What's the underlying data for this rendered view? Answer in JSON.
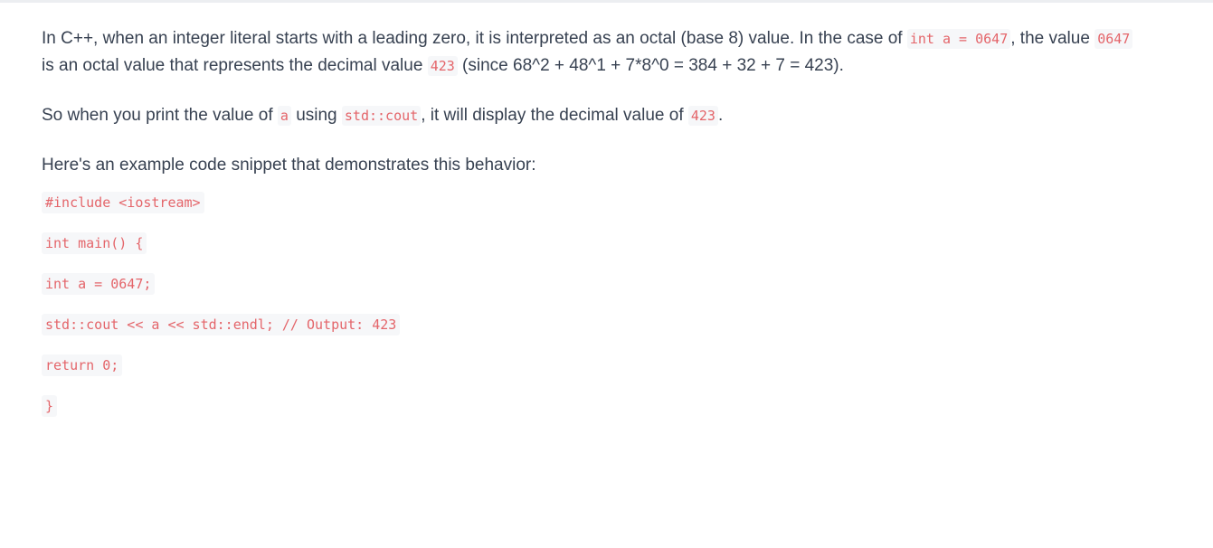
{
  "para1": {
    "line1_text_a": "In C++, when an integer literal starts with a leading zero, it is interpreted as an octal (base 8) value. In the case of ",
    "line1_code_a": "int a = 0647",
    "line1_text_b": ", the value ",
    "line1_code_b": "0647",
    "line2_text_a": "is an octal value that represents the decimal value ",
    "line2_code_a": "423",
    "line2_text_b": " (since 68^2 + 48^1 + 7*8^0 = 384 + 32 + 7 = 423)."
  },
  "para2": {
    "text_a": "So when you print the value of ",
    "code_a": "a",
    "text_b": " using ",
    "code_b": "std::cout",
    "text_c": ", it will display the decimal value of ",
    "code_c": "423",
    "text_d": "."
  },
  "para3": {
    "text": "Here's an example code snippet that demonstrates this behavior:"
  },
  "code_lines": [
    "#include <iostream>",
    "int main() {",
    "int a = 0647;",
    "std::cout << a << std::endl; // Output: 423",
    "return 0;",
    "}"
  ]
}
